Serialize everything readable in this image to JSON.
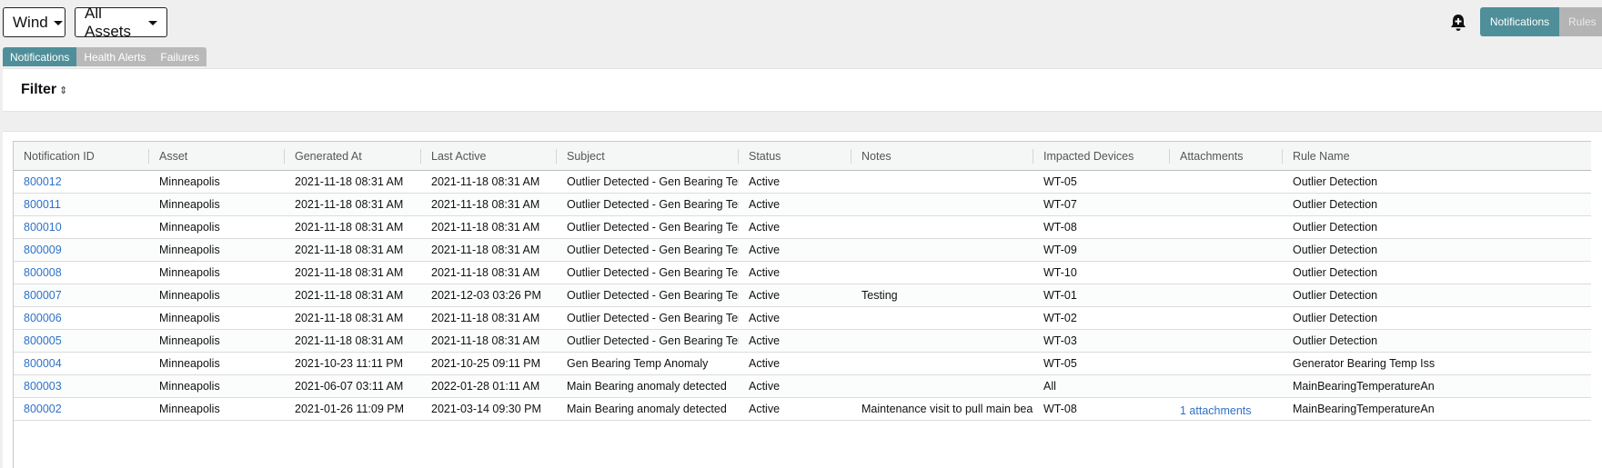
{
  "toolbar": {
    "domain_select": "Wind",
    "asset_select": "All Assets",
    "view_toggle": {
      "notifications": "Notifications",
      "rules": "Rules"
    }
  },
  "tabs": [
    "Notifications",
    "Health Alerts",
    "Failures"
  ],
  "filter": {
    "title": "Filter",
    "sort_icon": "⇕"
  },
  "table": {
    "columns": [
      "Notification ID",
      "Asset",
      "Generated At",
      "Last Active",
      "Subject",
      "Status",
      "Notes",
      "Impacted Devices",
      "Attachments",
      "Rule Name"
    ],
    "rows": [
      [
        "800012",
        "Minneapolis",
        "2021-11-18 08:31 AM",
        "2021-11-18 08:31 AM",
        "Outlier Detected - Gen Bearing Temp",
        "Active",
        "",
        "WT-05",
        "",
        "Outlier Detection"
      ],
      [
        "800011",
        "Minneapolis",
        "2021-11-18 08:31 AM",
        "2021-11-18 08:31 AM",
        "Outlier Detected - Gen Bearing Temp",
        "Active",
        "",
        "WT-07",
        "",
        "Outlier Detection"
      ],
      [
        "800010",
        "Minneapolis",
        "2021-11-18 08:31 AM",
        "2021-11-18 08:31 AM",
        "Outlier Detected - Gen Bearing Temp",
        "Active",
        "",
        "WT-08",
        "",
        "Outlier Detection"
      ],
      [
        "800009",
        "Minneapolis",
        "2021-11-18 08:31 AM",
        "2021-11-18 08:31 AM",
        "Outlier Detected - Gen Bearing Temp",
        "Active",
        "",
        "WT-09",
        "",
        "Outlier Detection"
      ],
      [
        "800008",
        "Minneapolis",
        "2021-11-18 08:31 AM",
        "2021-11-18 08:31 AM",
        "Outlier Detected - Gen Bearing Temp",
        "Active",
        "",
        "WT-10",
        "",
        "Outlier Detection"
      ],
      [
        "800007",
        "Minneapolis",
        "2021-11-18 08:31 AM",
        "2021-12-03 03:26 PM",
        "Outlier Detected - Gen Bearing Temp",
        "Active",
        "Testing",
        "WT-01",
        "",
        "Outlier Detection"
      ],
      [
        "800006",
        "Minneapolis",
        "2021-11-18 08:31 AM",
        "2021-11-18 08:31 AM",
        "Outlier Detected - Gen Bearing Temp",
        "Active",
        "",
        "WT-02",
        "",
        "Outlier Detection"
      ],
      [
        "800005",
        "Minneapolis",
        "2021-11-18 08:31 AM",
        "2021-11-18 08:31 AM",
        "Outlier Detected - Gen Bearing Temp",
        "Active",
        "",
        "WT-03",
        "",
        "Outlier Detection"
      ],
      [
        "800004",
        "Minneapolis",
        "2021-10-23 11:11 PM",
        "2021-10-25 09:11 PM",
        "Gen Bearing Temp Anomaly",
        "Active",
        "",
        "WT-05",
        "",
        "Generator Bearing Temp Iss"
      ],
      [
        "800003",
        "Minneapolis",
        "2021-06-07 03:11 AM",
        "2022-01-28 01:11 AM",
        "Main Bearing anomaly detected",
        "Active",
        "",
        "All",
        "",
        "MainBearingTemperatureAn"
      ],
      [
        "800002",
        "Minneapolis",
        "2021-01-26 11:09 PM",
        "2021-03-14 09:30 PM",
        "Main Bearing anomaly detected",
        "Active",
        "Maintenance visit to pull main bearing",
        "WT-08",
        "1 attachments",
        "MainBearingTemperatureAn"
      ]
    ]
  }
}
